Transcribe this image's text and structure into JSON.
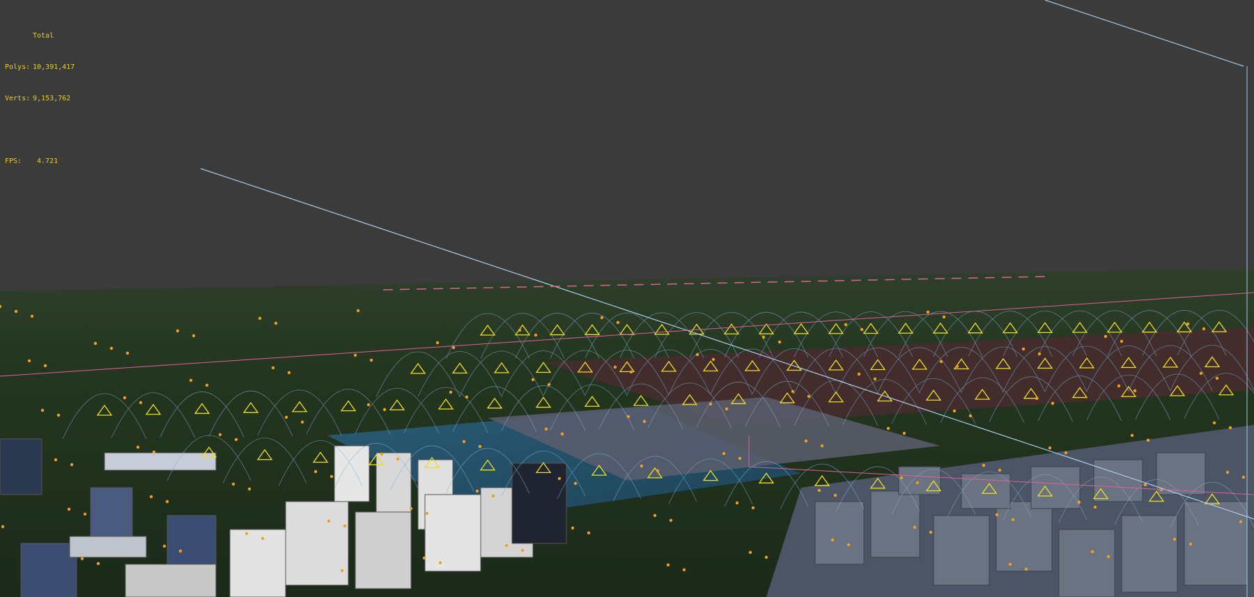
{
  "stats": {
    "title": "Total",
    "polys_label": "Polys:",
    "polys_value": "10,391,417",
    "verts_label": "Verts:",
    "verts_value": "9,153,762",
    "fps_label": "FPS:",
    "fps_value": "4.721"
  },
  "colors": {
    "background": "#3b3b3b",
    "stats_text": "#e8d21a",
    "wireframe": "#7fb2d8",
    "light_gizmo": "#f0e020",
    "selection": "#e0609a"
  }
}
